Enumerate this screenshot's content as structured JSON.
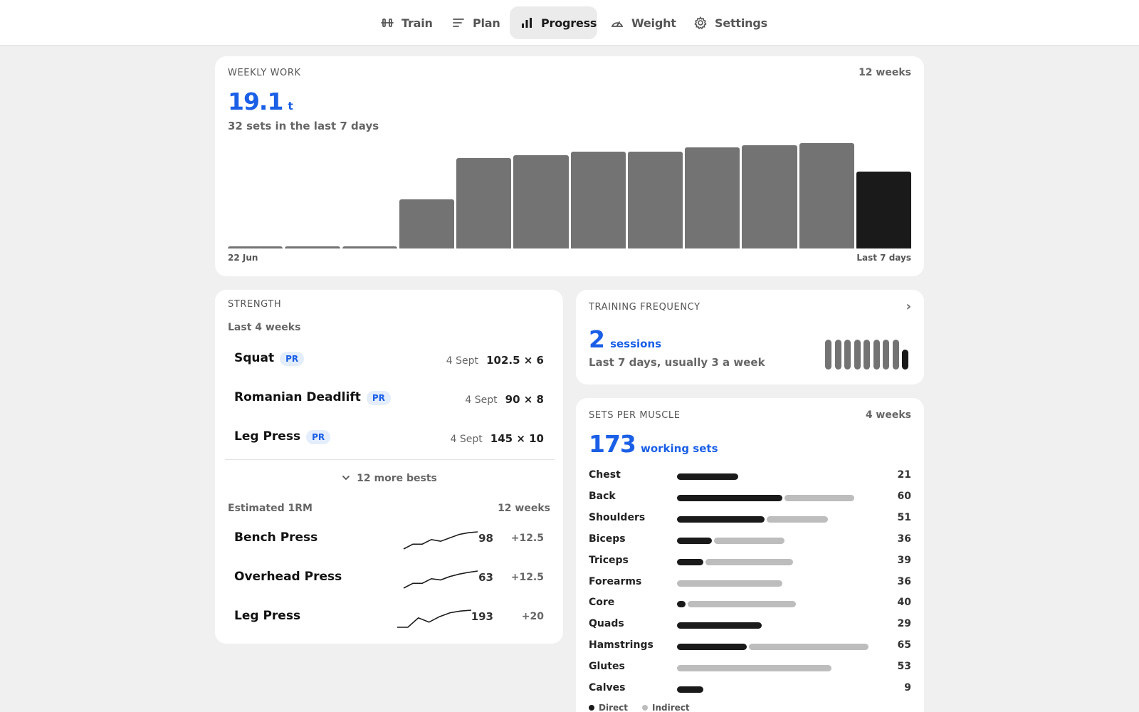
{
  "nav": {
    "tabs": [
      {
        "label": "Train",
        "icon": "dumbbell-icon"
      },
      {
        "label": "Plan",
        "icon": "list-icon"
      },
      {
        "label": "Progress",
        "icon": "bar-chart-icon",
        "active": true
      },
      {
        "label": "Weight",
        "icon": "gauge-icon"
      },
      {
        "label": "Settings",
        "icon": "gear-icon"
      }
    ]
  },
  "weekly": {
    "title": "WEEKLY WORK",
    "range": "12 weeks",
    "value": "19.1",
    "unit": "t",
    "subtitle": "32 sets in the last 7 days",
    "x_start": "22 Jun",
    "x_end": "Last 7 days"
  },
  "chart_data": {
    "type": "bar",
    "values": [
      0.4,
      0.4,
      0.4,
      8.4,
      15.5,
      15.9,
      16.6,
      16.6,
      17.3,
      17.7,
      18.0,
      13.2
    ],
    "highlight_last": true
  },
  "strength": {
    "title": "STRENGTH",
    "period": "Last 4 weeks",
    "bests": [
      {
        "name": "Squat",
        "badge": "PR",
        "date": "4 Sept",
        "value": "102.5 × 6"
      },
      {
        "name": "Romanian Deadlift",
        "badge": "PR",
        "date": "4 Sept",
        "value": "90 × 8"
      },
      {
        "name": "Leg Press",
        "badge": "PR",
        "date": "4 Sept",
        "value": "145 × 10"
      }
    ],
    "more_label": "12 more bests",
    "e1rm_title": "Estimated 1RM",
    "e1rm_range": "12 weeks",
    "e1rm": [
      {
        "name": "Bench Press",
        "value": "98",
        "delta": "+12.5",
        "trend": [
          0.0,
          0.28,
          0.28,
          0.55,
          0.45,
          0.65,
          0.85,
          0.95,
          1.0
        ]
      },
      {
        "name": "Overhead Press",
        "value": "63",
        "delta": "+12.5",
        "trend": [
          0.0,
          0.28,
          0.28,
          0.55,
          0.48,
          0.68,
          0.82,
          0.92,
          1.0
        ]
      },
      {
        "name": "Leg Press",
        "value": "193",
        "delta": "+20",
        "trend": [
          0.0,
          0.0,
          0.55,
          0.3,
          0.62,
          0.85,
          0.95,
          1.0
        ]
      }
    ]
  },
  "frequency": {
    "title": "TRAINING FREQUENCY",
    "chevron": "›",
    "value": "2",
    "unit": "sessions",
    "subtitle": "Last 7 days, usually 3 a week",
    "weekly_sessions": [
      3,
      3,
      3,
      3,
      3,
      3,
      3,
      3,
      2
    ]
  },
  "muscles": {
    "title": "SETS PER MUSCLE",
    "range": "4 weeks",
    "value": "173",
    "unit": "working sets",
    "items": [
      {
        "name": "Chest",
        "direct": 21,
        "indirect": 0,
        "total": "21"
      },
      {
        "name": "Back",
        "direct": 36,
        "indirect": 24,
        "total": "60"
      },
      {
        "name": "Shoulders",
        "direct": 30,
        "indirect": 21,
        "total": "51"
      },
      {
        "name": "Biceps",
        "direct": 12,
        "indirect": 24,
        "total": "36"
      },
      {
        "name": "Triceps",
        "direct": 9,
        "indirect": 30,
        "total": "39"
      },
      {
        "name": "Forearms",
        "direct": 0,
        "indirect": 36,
        "total": "36"
      },
      {
        "name": "Core",
        "direct": 3,
        "indirect": 37,
        "total": "40"
      },
      {
        "name": "Quads",
        "direct": 29,
        "indirect": 0,
        "total": "29"
      },
      {
        "name": "Hamstrings",
        "direct": 24,
        "indirect": 41,
        "total": "65"
      },
      {
        "name": "Glutes",
        "direct": 0,
        "indirect": 53,
        "total": "53"
      },
      {
        "name": "Calves",
        "direct": 9,
        "indirect": 0,
        "total": "9"
      }
    ],
    "legend_direct": "Direct",
    "legend_indirect": "Indirect"
  },
  "colors": {
    "accent": "#1a5fe6",
    "bar": "#737373",
    "bar_current": "#1a1a1a",
    "indirect": "#bdbdbd"
  }
}
